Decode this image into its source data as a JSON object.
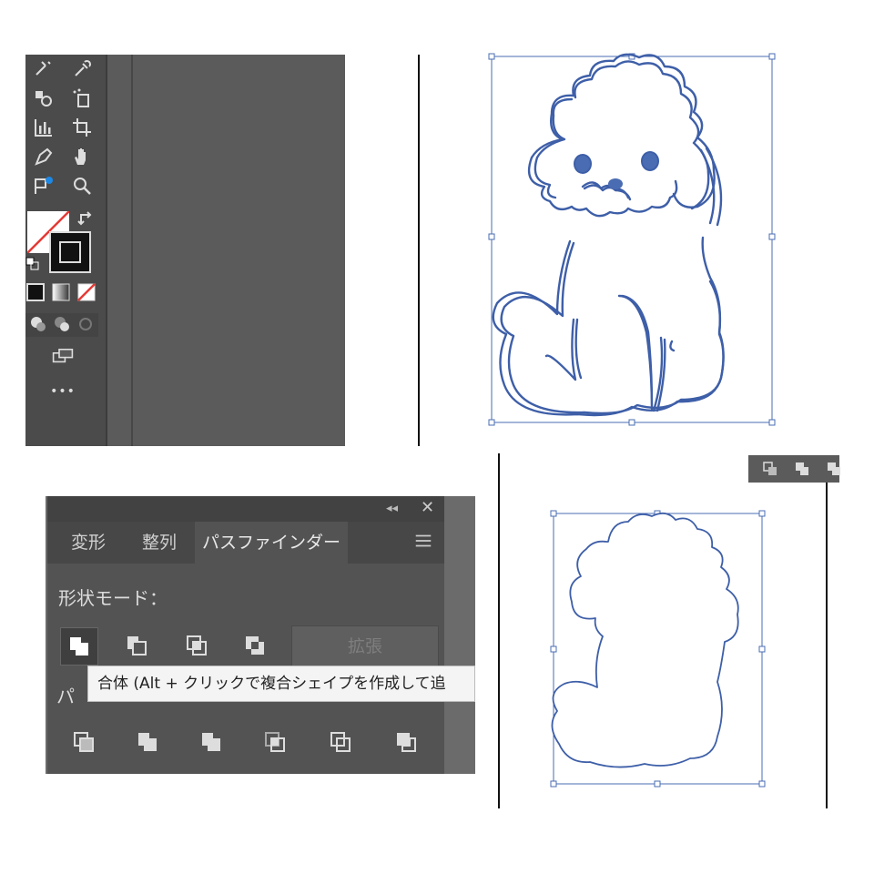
{
  "toolbar": {
    "more_label": "•••"
  },
  "pathfinder": {
    "tabs": [
      "変形",
      "整列",
      "パスファインダー"
    ],
    "active_tab": 2,
    "shape_modes_label": "形状モード：",
    "expand_label": "拡張",
    "pathfinders_label": "パ",
    "tooltip": "合体 (Alt + クリックで複合シェイプを作成して追"
  },
  "colors": {
    "panel_bg": "#535353",
    "toolbar_bg": "#5b5b5b",
    "selection_blue": "#4a6cb3",
    "path_blue": "#3e5fa8"
  }
}
